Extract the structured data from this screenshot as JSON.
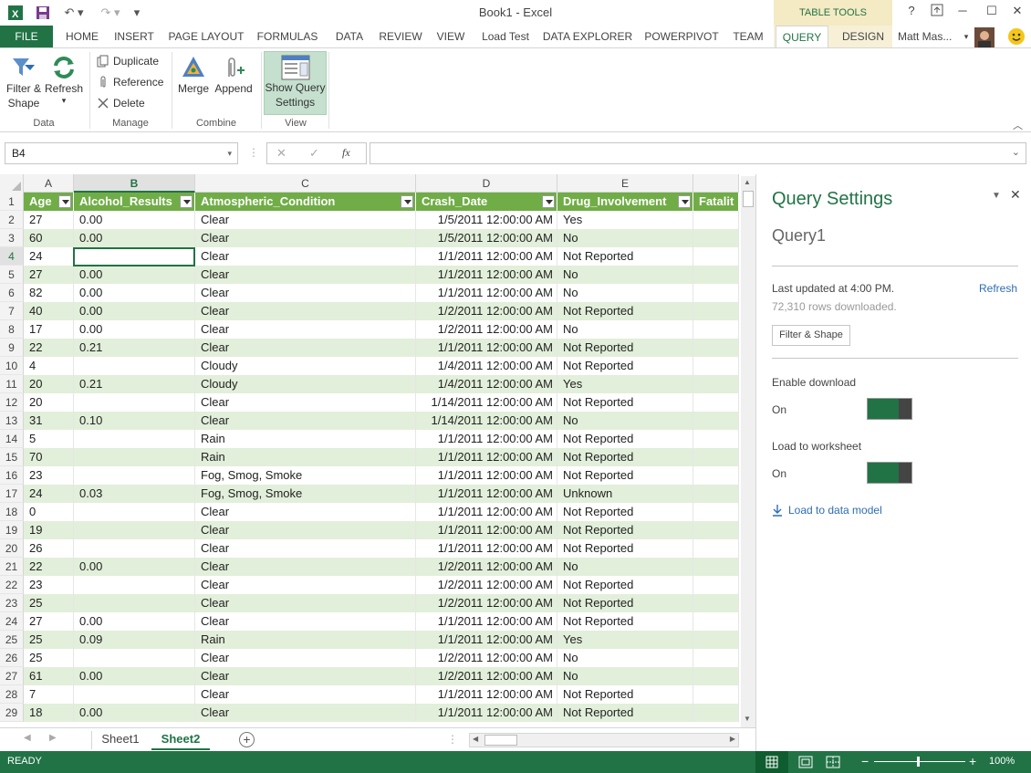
{
  "window": {
    "title": "Book1 - Excel",
    "table_tools_label": "TABLE TOOLS",
    "user_name": "Matt Mas...",
    "help_glyph": "?",
    "colors": {
      "excel_green": "#217346",
      "table_header": "#70ad47",
      "band": "#e2efda"
    }
  },
  "tabs": [
    "FILE",
    "HOME",
    "INSERT",
    "PAGE LAYOUT",
    "FORMULAS",
    "DATA",
    "REVIEW",
    "VIEW",
    "Load Test",
    "DATA EXPLORER",
    "POWERPIVOT",
    "TEAM",
    "QUERY",
    "DESIGN"
  ],
  "ribbon": {
    "filter_shape": "Filter &\nShape",
    "refresh": "Refresh",
    "data_group": "Data",
    "duplicate": "Duplicate",
    "reference": "Reference",
    "delete": "Delete",
    "manage_group": "Manage",
    "merge": "Merge",
    "append": "Append",
    "combine_group": "Combine",
    "show_query_settings": "Show Query\nSettings",
    "view_group": "View"
  },
  "formula_bar": {
    "name_box": "B4",
    "fx": "fx",
    "value": ""
  },
  "grid": {
    "column_letters": [
      "A",
      "B",
      "C",
      "D",
      "E"
    ],
    "selected_column": "B",
    "selected_row": 4,
    "headers": [
      "Age",
      "Alcohol_Results",
      "Atmospheric_Condition",
      "Crash_Date",
      "Drug_Involvement",
      "Fatalit"
    ],
    "rows": [
      [
        "27",
        "0.00",
        "Clear",
        "1/5/2011 12:00:00 AM",
        "Yes"
      ],
      [
        "60",
        "0.00",
        "Clear",
        "1/5/2011 12:00:00 AM",
        "No"
      ],
      [
        "24",
        "",
        "Clear",
        "1/1/2011 12:00:00 AM",
        "Not Reported"
      ],
      [
        "27",
        "0.00",
        "Clear",
        "1/1/2011 12:00:00 AM",
        "No"
      ],
      [
        "82",
        "0.00",
        "Clear",
        "1/1/2011 12:00:00 AM",
        "No"
      ],
      [
        "40",
        "0.00",
        "Clear",
        "1/2/2011 12:00:00 AM",
        "Not Reported"
      ],
      [
        "17",
        "0.00",
        "Clear",
        "1/2/2011 12:00:00 AM",
        "No"
      ],
      [
        "22",
        "0.21",
        "Clear",
        "1/1/2011 12:00:00 AM",
        "Not Reported"
      ],
      [
        "4",
        "",
        "Cloudy",
        "1/4/2011 12:00:00 AM",
        "Not Reported"
      ],
      [
        "20",
        "0.21",
        "Cloudy",
        "1/4/2011 12:00:00 AM",
        "Yes"
      ],
      [
        "20",
        "",
        "Clear",
        "1/14/2011 12:00:00 AM",
        "Not Reported"
      ],
      [
        "31",
        "0.10",
        "Clear",
        "1/14/2011 12:00:00 AM",
        "No"
      ],
      [
        "5",
        "",
        "Rain",
        "1/1/2011 12:00:00 AM",
        "Not Reported"
      ],
      [
        "70",
        "",
        "Rain",
        "1/1/2011 12:00:00 AM",
        "Not Reported"
      ],
      [
        "23",
        "",
        "Fog, Smog, Smoke",
        "1/1/2011 12:00:00 AM",
        "Not Reported"
      ],
      [
        "24",
        "0.03",
        "Fog, Smog, Smoke",
        "1/1/2011 12:00:00 AM",
        "Unknown"
      ],
      [
        "0",
        "",
        "Clear",
        "1/1/2011 12:00:00 AM",
        "Not Reported"
      ],
      [
        "19",
        "",
        "Clear",
        "1/1/2011 12:00:00 AM",
        "Not Reported"
      ],
      [
        "26",
        "",
        "Clear",
        "1/1/2011 12:00:00 AM",
        "Not Reported"
      ],
      [
        "22",
        "0.00",
        "Clear",
        "1/2/2011 12:00:00 AM",
        "No"
      ],
      [
        "23",
        "",
        "Clear",
        "1/2/2011 12:00:00 AM",
        "Not Reported"
      ],
      [
        "25",
        "",
        "Clear",
        "1/2/2011 12:00:00 AM",
        "Not Reported"
      ],
      [
        "27",
        "0.00",
        "Clear",
        "1/1/2011 12:00:00 AM",
        "Not Reported"
      ],
      [
        "25",
        "0.09",
        "Rain",
        "1/1/2011 12:00:00 AM",
        "Yes"
      ],
      [
        "25",
        "",
        "Clear",
        "1/2/2011 12:00:00 AM",
        "No"
      ],
      [
        "61",
        "0.00",
        "Clear",
        "1/2/2011 12:00:00 AM",
        "No"
      ],
      [
        "7",
        "",
        "Clear",
        "1/1/2011 12:00:00 AM",
        "Not Reported"
      ],
      [
        "18",
        "0.00",
        "Clear",
        "1/1/2011 12:00:00 AM",
        "Not Reported"
      ]
    ]
  },
  "sheets": [
    "Sheet1",
    "Sheet2"
  ],
  "active_sheet": "Sheet2",
  "query_settings": {
    "title": "Query Settings",
    "query_name": "Query1",
    "last_updated": "Last updated at 4:00 PM.",
    "refresh_link": "Refresh",
    "rows_downloaded": "72,310 rows downloaded.",
    "filter_shape_button": "Filter & Shape",
    "enable_download_label": "Enable download",
    "enable_download_state": "On",
    "load_to_worksheet_label": "Load to worksheet",
    "load_to_worksheet_state": "On",
    "load_to_data_model": "Load to data model"
  },
  "status": {
    "ready": "READY",
    "zoom": "100%"
  }
}
